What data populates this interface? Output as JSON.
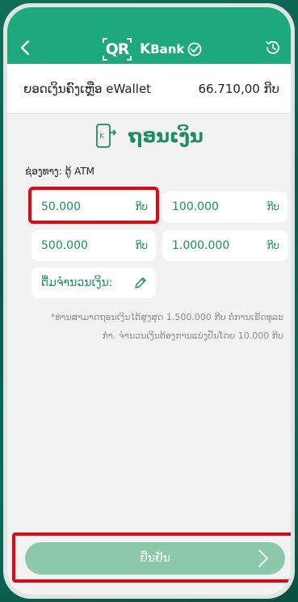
{
  "header": {
    "logo_qr": "QR",
    "brand_k": "K",
    "brand_rest": "Bank",
    "color": "#1ea97c"
  },
  "balance": {
    "label": "ຍອດເງິນຄົງເຫຼືອ eWallet",
    "value": "66.710,00 ກີບ"
  },
  "page": {
    "title": "ຖອນເງິນ"
  },
  "channel": "ຊ່ອງທາງ: ຕູ້ ATM",
  "amounts": [
    {
      "value": "50.000",
      "currency": "ກີບ",
      "selected": true
    },
    {
      "value": "100.000",
      "currency": "ກີບ"
    },
    {
      "value": "500.000",
      "currency": "ກີບ"
    },
    {
      "value": "1.000.000",
      "currency": "ກີບ"
    }
  ],
  "custom_amount": {
    "label": "ຕື່ມຈຳນວນເງິນ:"
  },
  "note": {
    "line1": "*ທ່ານສາມາດຖອນເງິນໄດ້ສູງສຸດ 1.500.000 ກີບ ຕໍ່ການເຮັດທຸລະ",
    "line2": "ກຳ. ຈຳນວນເງິນຕ້ອງການແບ່ງປັນໂດຍ 10.000 ກີບ"
  },
  "confirm": {
    "label": "ຢືນຢັນ"
  },
  "colors": {
    "accent": "#1ea97c",
    "accent_text": "#1a8f60",
    "highlight": "#e30613",
    "disabled_button": "#8cc9ab"
  },
  "icons": {
    "back": "chevron-left-icon",
    "history": "history-clock-icon",
    "withdraw": "withdraw-phone-icon",
    "edit": "pencil-icon",
    "next": "chevron-right-icon"
  }
}
